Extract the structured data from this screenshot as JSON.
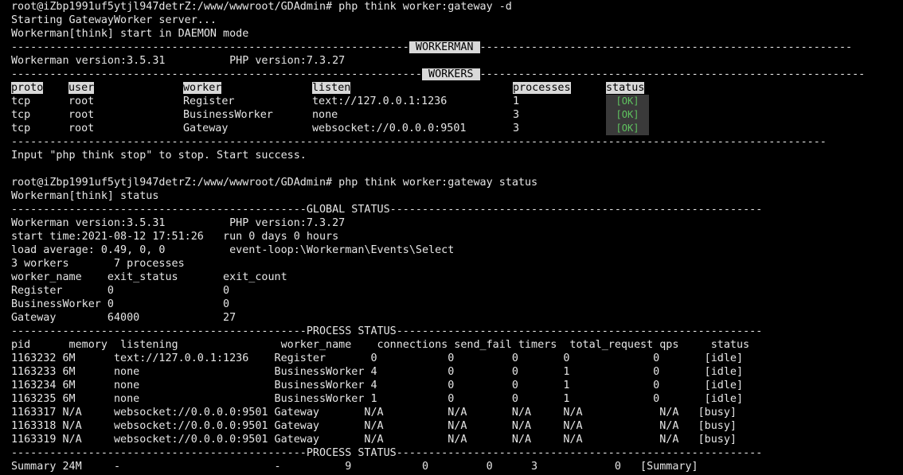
{
  "terminal": {
    "lines": [
      "root@iZbp1991uf5ytjl947detrZ:/www/wwwroot/GDAdmin# php think worker:gateway -d",
      "Starting GatewayWorker server...",
      "Workerman[think] start in DAEMON mode",
      "Workerman version:3.5.31          PHP version:7.3.27",
      "Input \"php think stop\" to stop. Start success.",
      "",
      "root@iZbp1991uf5ytjl947detrZ:/www/wwwroot/GDAdmin# php think worker:gateway status",
      "Workerman[think] status",
      "Workerman version:3.5.31          PHP version:7.3.27",
      "start time:2021-08-12 17:51:26   run 0 days 0 hours",
      "load average: 0.49, 0, 0          event-loop:\\Workerman\\Events\\Select",
      "3 workers       7 processes",
      "worker_name    exit_status       exit_count",
      "Register       0                 0",
      "BusinessWorker 0                 0",
      "Gateway        64000             27",
      "pid      memory  listening                worker_name    connections send_fail timers  total_request qps     status",
      "1163232 6M      text://127.0.0.1:1236    Register       0           0         0       0             0       [idle]",
      "1163233 6M      none                     BusinessWorker 4           0         0       1             0       [idle]",
      "1163234 6M      none                     BusinessWorker 4           0         0       1             0       [idle]",
      "1163235 6M      none                     BusinessWorker 1           0         0       1             0       [idle]",
      "1163317 N/A     websocket://0.0.0.0:9501 Gateway       N/A          N/A       N/A     N/A            N/A   [busy]",
      "1163318 N/A     websocket://0.0.0.0:9501 Gateway       N/A          N/A       N/A     N/A            N/A   [busy]",
      "1163319 N/A     websocket://0.0.0.0:9501 Gateway       N/A          N/A       N/A     N/A            N/A   [busy]",
      "Summary 24M     -                        -          9           0         0      3            0   [Summary]"
    ],
    "sep_workerman": " WORKERMAN ",
    "sep_workers": " WORKERS ",
    "sep_global": "GLOBAL STATUS",
    "sep_process": "PROCESS STATUS",
    "workers_header": {
      "proto": "proto",
      "user": "user",
      "worker": "worker",
      "listen": "listen",
      "processes": "processes",
      "status": "status"
    },
    "workers_rows": [
      {
        "proto": "tcp",
        "user": "root",
        "worker": "Register",
        "listen": "text://127.0.0.1:1236",
        "processes": "1",
        "status": "[OK]"
      },
      {
        "proto": "tcp",
        "user": "root",
        "worker": "BusinessWorker",
        "listen": "none",
        "processes": "3",
        "status": "[OK]"
      },
      {
        "proto": "tcp",
        "user": "root",
        "worker": "Gateway",
        "listen": "websocket://0.0.0.0:9501",
        "processes": "3",
        "status": "[OK]"
      }
    ]
  }
}
